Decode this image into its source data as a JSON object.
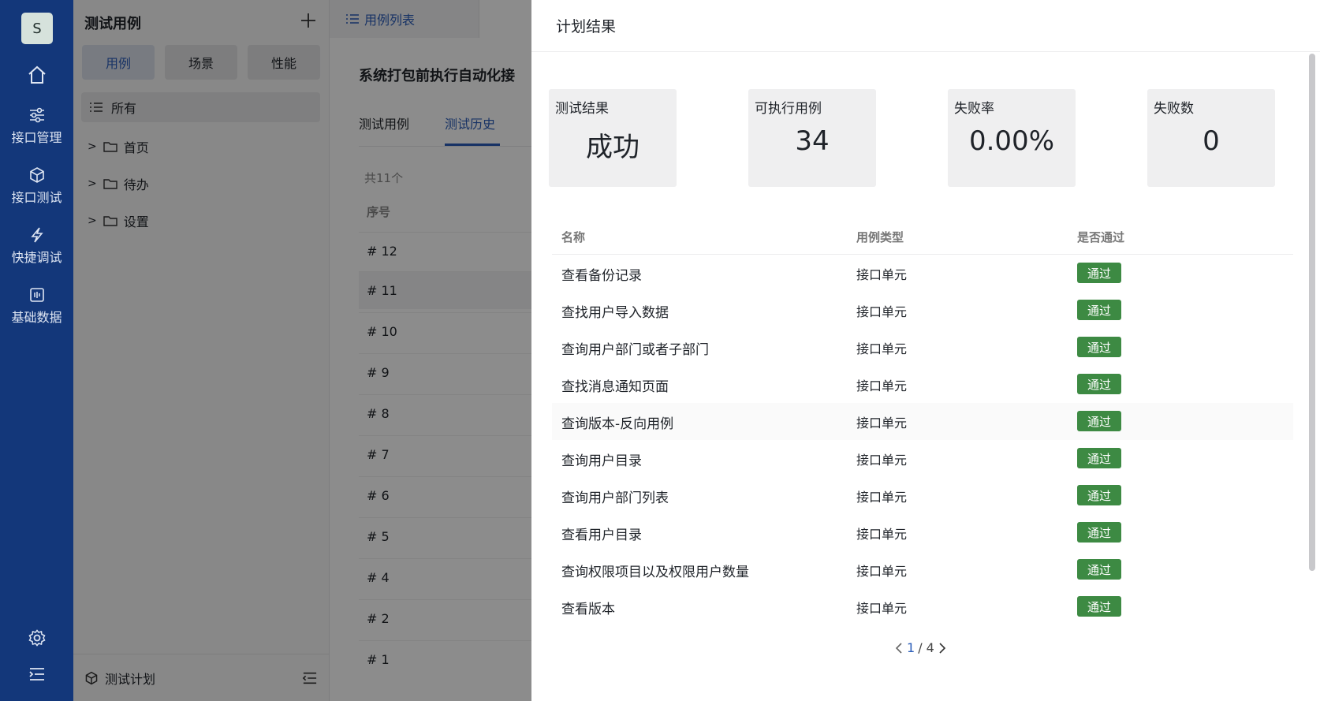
{
  "rail": {
    "avatar_letter": "S",
    "items": [
      {
        "icon": "home-icon",
        "label": ""
      },
      {
        "icon": "sliders-icon",
        "label": "接口管理"
      },
      {
        "icon": "cube-icon",
        "label": "接口测试"
      },
      {
        "icon": "lightning-icon",
        "label": "快捷调试"
      },
      {
        "icon": "database-icon",
        "label": "基础数据"
      }
    ],
    "bottom_icons": [
      "gear-icon",
      "collapse-menu-icon"
    ]
  },
  "tree": {
    "title": "测试用例",
    "segments": [
      "用例",
      "场景",
      "性能"
    ],
    "active_segment": 0,
    "all_label": "所有",
    "nodes": [
      "首页",
      "待办",
      "设置"
    ],
    "footer_label": "测试计划"
  },
  "main": {
    "tab_label": "用例列表",
    "plan_title": "系统打包前执行自动化接",
    "subtabs": [
      "测试用例",
      "测试历史"
    ],
    "active_subtab": 1,
    "count_text": "共11个",
    "col_seq": "序号",
    "rows": [
      "# 12",
      "# 11",
      "# 10",
      "# 9",
      "# 8",
      "# 7",
      "# 6",
      "# 5",
      "# 4",
      "# 2",
      "# 1"
    ]
  },
  "drawer": {
    "title": "计划结果",
    "stats": [
      {
        "title": "测试结果",
        "value": "成功"
      },
      {
        "title": "可执行用例",
        "value": "34"
      },
      {
        "title": "失败率",
        "value": "0.00%"
      },
      {
        "title": "失败数",
        "value": "0"
      }
    ],
    "columns": [
      "名称",
      "用例类型",
      "是否通过"
    ],
    "rows": [
      {
        "name": "查看备份记录",
        "type": "接口单元",
        "status": "通过"
      },
      {
        "name": "查找用户导入数据",
        "type": "接口单元",
        "status": "通过"
      },
      {
        "name": "查询用户部门或者子部门",
        "type": "接口单元",
        "status": "通过"
      },
      {
        "name": "查找消息通知页面",
        "type": "接口单元",
        "status": "通过"
      },
      {
        "name": "查询版本-反向用例",
        "type": "接口单元",
        "status": "通过"
      },
      {
        "name": "查询用户目录",
        "type": "接口单元",
        "status": "通过"
      },
      {
        "name": "查询用户部门列表",
        "type": "接口单元",
        "status": "通过"
      },
      {
        "name": "查看用户目录",
        "type": "接口单元",
        "status": "通过"
      },
      {
        "name": "查询权限项目以及权限用户数量",
        "type": "接口单元",
        "status": "通过"
      },
      {
        "name": "查看版本",
        "type": "接口单元",
        "status": "通过"
      }
    ],
    "pager": {
      "current": "1",
      "total": "/ 4"
    }
  },
  "colors": {
    "rail": "#13377a",
    "accent": "#2a5cb8",
    "pass": "#3d8a43"
  }
}
